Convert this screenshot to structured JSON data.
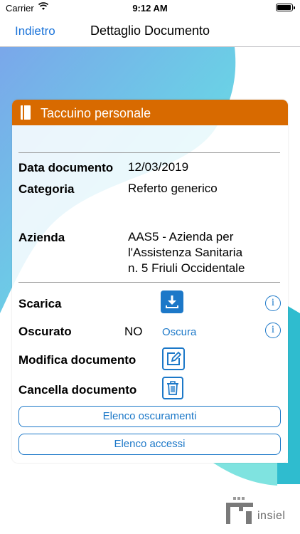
{
  "status_bar": {
    "carrier": "Carrier",
    "time": "9:12 AM"
  },
  "nav": {
    "back_label": "Indietro",
    "title": "Dettaglio Documento"
  },
  "card": {
    "header_title": "Taccuino personale",
    "header_color": "#d86a00",
    "fields": {
      "data_label": "Data documento",
      "data_value": "12/03/2019",
      "categoria_label": "Categoria",
      "categoria_value": "Referto generico",
      "azienda_label": "Azienda",
      "azienda_value_line1": "AAS5 - Azienda per",
      "azienda_value_line2": "l'Assistenza Sanitaria",
      "azienda_value_line3": "n. 5 Friuli Occidentale"
    },
    "actions": {
      "scarica_label": "Scarica",
      "oscurato_label": "Oscurato",
      "oscurato_value": "NO",
      "oscura_link": "Oscura",
      "modifica_label": "Modifica documento",
      "cancella_label": "Cancella documento",
      "elenco_oscuramenti": "Elenco oscuramenti",
      "elenco_accessi": "Elenco accessi",
      "info_glyph": "i"
    }
  },
  "logo": {
    "text": "insiel"
  },
  "colors": {
    "accent": "#1c78c8",
    "nav_link": "#1a73d9",
    "teal": "#4fd6d6"
  }
}
